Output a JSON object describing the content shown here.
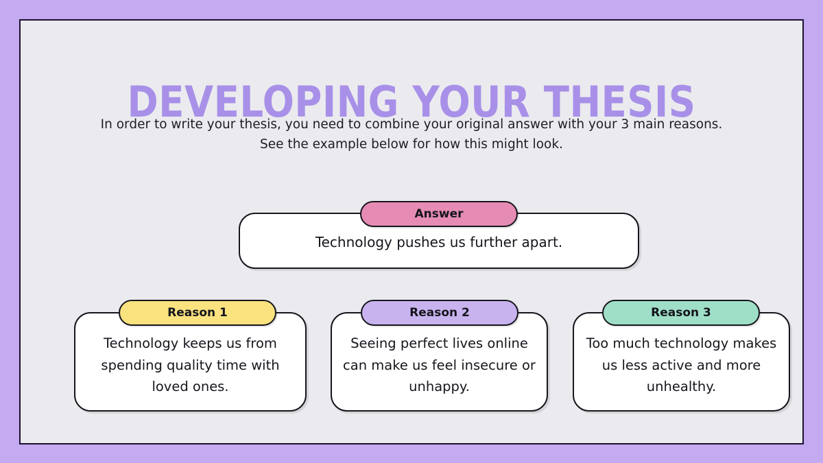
{
  "slide": {
    "title": "DEVELOPING YOUR THESIS",
    "subtitle_line_1": "In order to write your thesis, you need to combine your original answer with your 3 main reasons.",
    "subtitle_line_2": "See the example below for how this might look.",
    "background_color": "#c4aaf0",
    "panel_color": "#ebebef",
    "title_color": "#a890e8",
    "border_color": "#1a1030"
  },
  "answer": {
    "badge_label": "Answer",
    "badge_color": "#e68cb4",
    "text": "Technology pushes us further apart."
  },
  "reasons": [
    {
      "badge_label": "Reason 1",
      "badge_color": "#fae27e",
      "text": "Technology keeps us from spending quality time with loved ones."
    },
    {
      "badge_label": "Reason 2",
      "badge_color": "#c9b3ef",
      "text": "Seeing perfect lives online can make us feel insecure or unhappy."
    },
    {
      "badge_label": "Reason 3",
      "badge_color": "#9fdfc8",
      "text": "Too much technology makes us less active and more unhealthy."
    }
  ]
}
